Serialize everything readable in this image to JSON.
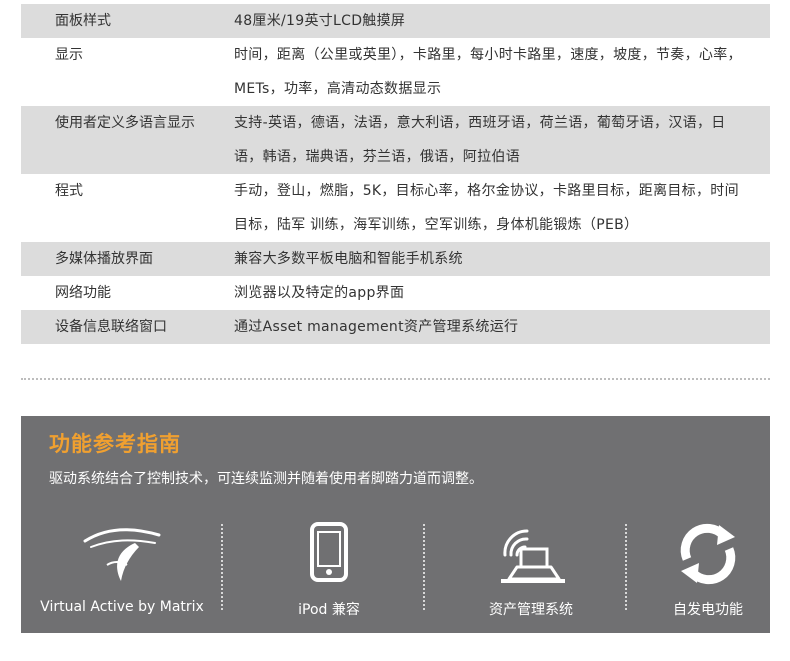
{
  "specs": [
    {
      "key": "面板样式",
      "value": "48厘米/19英寸LCD触摸屏"
    },
    {
      "key": "显示",
      "value": "时间，距离（公里或英里），卡路里，每小时卡路里，速度，坡度，节奏，心率，METs，功率，高清动态数据显示"
    },
    {
      "key": "使用者定义多语言显示",
      "value": "支持-英语，德语，法语，意大利语，西班牙语，荷兰语，葡萄牙语，汉语，日语，韩语，瑞典语，芬兰语，俄语，阿拉伯语"
    },
    {
      "key": "程式",
      "value": "手动，登山，燃脂，5K，目标心率，格尔金协议，卡路里目标，距离目标，时间目标，陆军 训练，海军训练，空军训练，身体机能锻炼（PEB）"
    },
    {
      "key": "多媒体播放界面",
      "value": "兼容大多数平板电脑和智能手机系统"
    },
    {
      "key": "网络功能",
      "value": "浏览器以及特定的app界面"
    },
    {
      "key": "设备信息联络窗口",
      "value": "通过Asset management资产管理系统运行"
    }
  ],
  "guide": {
    "title": "功能参考指南",
    "description": "驱动系统结合了控制技术，可连续监测并随着使用者脚踏力道而调整。",
    "features": [
      {
        "label": "Virtual Active by Matrix",
        "icon": "virtual-active-icon"
      },
      {
        "label": "iPod 兼容",
        "icon": "ipod-icon"
      },
      {
        "label": "资产管理系统",
        "icon": "asset-management-icon"
      },
      {
        "label": "自发电功能",
        "icon": "self-power-icon"
      }
    ]
  },
  "colors": {
    "row_shade": "#dcdcdc",
    "panel_bg": "#707072",
    "title_accent": "#f0a030"
  }
}
